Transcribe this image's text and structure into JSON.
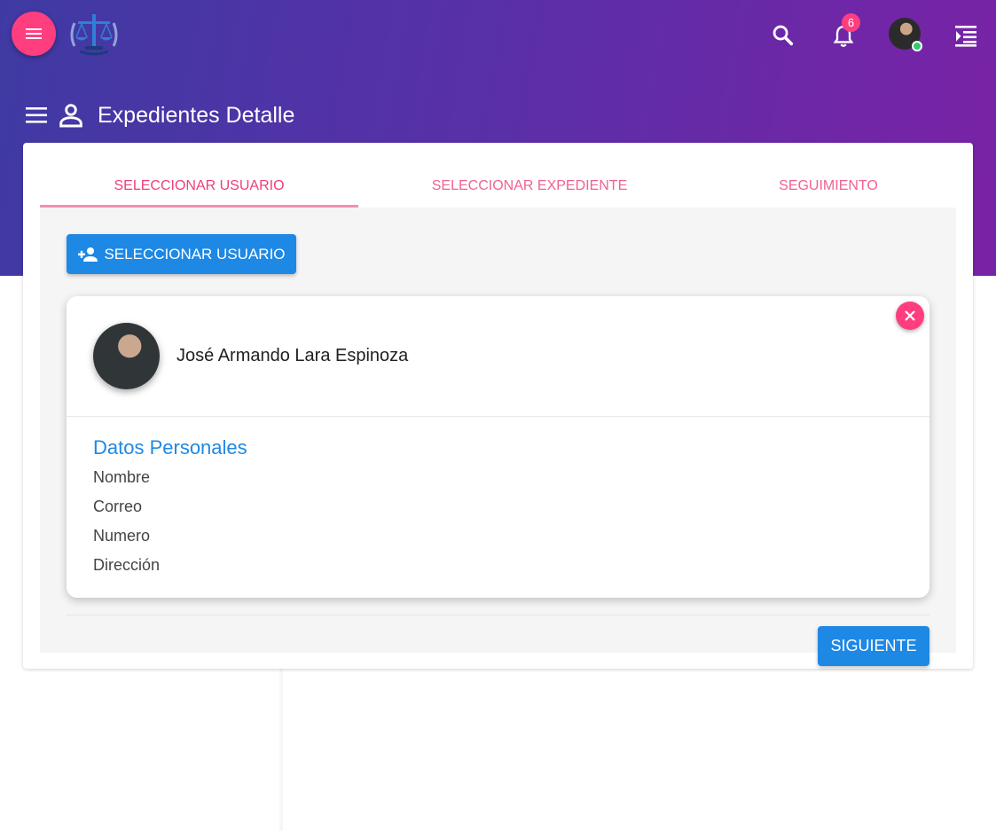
{
  "header": {
    "notification_count": "6",
    "icons": [
      "menu-icon",
      "scales-logo",
      "search-icon",
      "bell-icon",
      "avatar",
      "menu-open-icon"
    ]
  },
  "page": {
    "title": "Expedientes Detalle"
  },
  "tabs": [
    {
      "label": "SELECCIONAR USUARIO",
      "active": true
    },
    {
      "label": "SELECCIONAR EXPEDIENTE",
      "active": false
    },
    {
      "label": "SEGUIMIENTO",
      "active": false
    }
  ],
  "select_user_button": "SELECCIONAR USUARIO",
  "user": {
    "name": "José Armando Lara Espinoza",
    "section_title": "Datos Personales",
    "fields": [
      "Nombre",
      "Correo",
      "Numero",
      "Dirección"
    ]
  },
  "next_button": "SIGUIENTE",
  "colors": {
    "accent_pink": "#ff3e7f",
    "primary_blue": "#1e88e5",
    "gradient_start": "#3f3aa3",
    "gradient_end": "#7a22a6"
  }
}
